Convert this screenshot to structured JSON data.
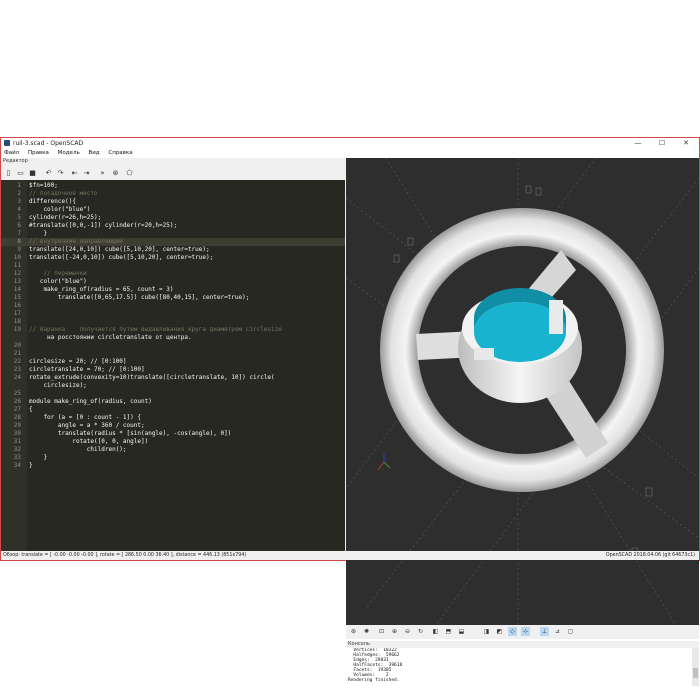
{
  "window": {
    "title": "ruil-3.scad - OpenSCAD",
    "minimize": "—",
    "maximize": "☐",
    "close": "✕"
  },
  "menu": [
    "Файл",
    "Правка",
    "Модель",
    "Вид",
    "Справка"
  ],
  "editor": {
    "header": "Редактор",
    "toolbar_icons": [
      "new-file-icon",
      "open-file-icon",
      "save-icon",
      "undo-icon",
      "redo-icon",
      "unindent-icon",
      "indent-icon",
      "preview-icon",
      "render-icon",
      "export-stl-icon"
    ],
    "export_label": "STL",
    "lines": [
      {
        "n": "1",
        "t": "$fn=100;"
      },
      {
        "n": "2",
        "t": "// посадочное место"
      },
      {
        "n": "3",
        "t": "difference(){"
      },
      {
        "n": "4",
        "t": "    color(\"blue\")"
      },
      {
        "n": "5",
        "t": "cylinder(r=26,h=25);"
      },
      {
        "n": "6",
        "t": "#translate([0,0,-1]) cylinder(r=20,h=25);"
      },
      {
        "n": "7",
        "t": "    }"
      },
      {
        "n": "8",
        "t": "// внутренние направляющие"
      },
      {
        "n": "9",
        "t": "translate([24,0,10]) cube([5,10,20], center=true);"
      },
      {
        "n": "10",
        "t": "translate([-24,0,10]) cube([5,10,20], center=true);"
      },
      {
        "n": "11",
        "t": ""
      },
      {
        "n": "12",
        "t": "    // перемычки"
      },
      {
        "n": "13",
        "t": "   color(\"blue\")"
      },
      {
        "n": "14",
        "t": "    make_ring_of(radius = 65, count = 3)"
      },
      {
        "n": "15",
        "t": "        translate([0,65,17.5]) cube([80,40,15], center=true);"
      },
      {
        "n": "16",
        "t": ""
      },
      {
        "n": "17",
        "t": ""
      },
      {
        "n": "18",
        "t": ""
      },
      {
        "n": "19",
        "t": "// баранка    получается путем выдавливания круга диаметром circlesize"
      },
      {
        "n": "",
        "t": "     на росстоянии circletranslate от центра."
      },
      {
        "n": "20",
        "t": ""
      },
      {
        "n": "21",
        "t": ""
      },
      {
        "n": "22",
        "t": "circlesize = 20; // [0:100]"
      },
      {
        "n": "23",
        "t": "circletranslate = 70; // [0:100]"
      },
      {
        "n": "24",
        "t": "rotate_extrude(convexity=10)translate([circletranslate, 10]) circle("
      },
      {
        "n": "",
        "t": "    circlesize);"
      },
      {
        "n": "25",
        "t": ""
      },
      {
        "n": "26",
        "t": "module make_ring_of(radius, count)"
      },
      {
        "n": "27",
        "t": "{"
      },
      {
        "n": "28",
        "t": "    for (a = [0 : count - 1]) {"
      },
      {
        "n": "29",
        "t": "        angle = a * 360 / count;"
      },
      {
        "n": "30",
        "t": "        translate(radius * [sin(angle), -cos(angle), 0])"
      },
      {
        "n": "31",
        "t": "            rotate([0, 0, angle])"
      },
      {
        "n": "32",
        "t": "                children();"
      },
      {
        "n": "33",
        "t": "    }"
      },
      {
        "n": "34",
        "t": "}"
      }
    ]
  },
  "viewport": {
    "background": "#2e2e2e",
    "model_color": "#e9e9e9",
    "highlight_color": "#17b3cf"
  },
  "view_toolbar_icons": [
    "render-view-icon",
    "preview-view-icon",
    "view-all-icon",
    "zoom-in-icon",
    "zoom-out-icon",
    "reset-view-icon",
    "view-right-icon",
    "view-top-icon",
    "view-bottom-icon",
    "view-left-icon",
    "view-front-icon",
    "view-back-icon",
    "view-diagonal-icon",
    "view-center-icon",
    "perspective-icon",
    "orthogonal-icon",
    "show-axes-icon",
    "show-edges-icon"
  ],
  "console": {
    "header": "Консоль",
    "lines": [
      "  Vertices:  10322",
      "  Halfedges:  59662",
      "  Edges:  29831",
      "  HalfFacets:  39618",
      "  Facets:  19305",
      "  Volumes:    2",
      "Rendering finished."
    ]
  },
  "status": {
    "left": "Обзор: translate = [ -0.00 -0.00 -0.00 ], rotate = [ 286.50 0.00 36.40 ], distance = 446.13 (851x794)",
    "right": "OpenSCAD 2018.04.06 (git 64673c1)"
  }
}
